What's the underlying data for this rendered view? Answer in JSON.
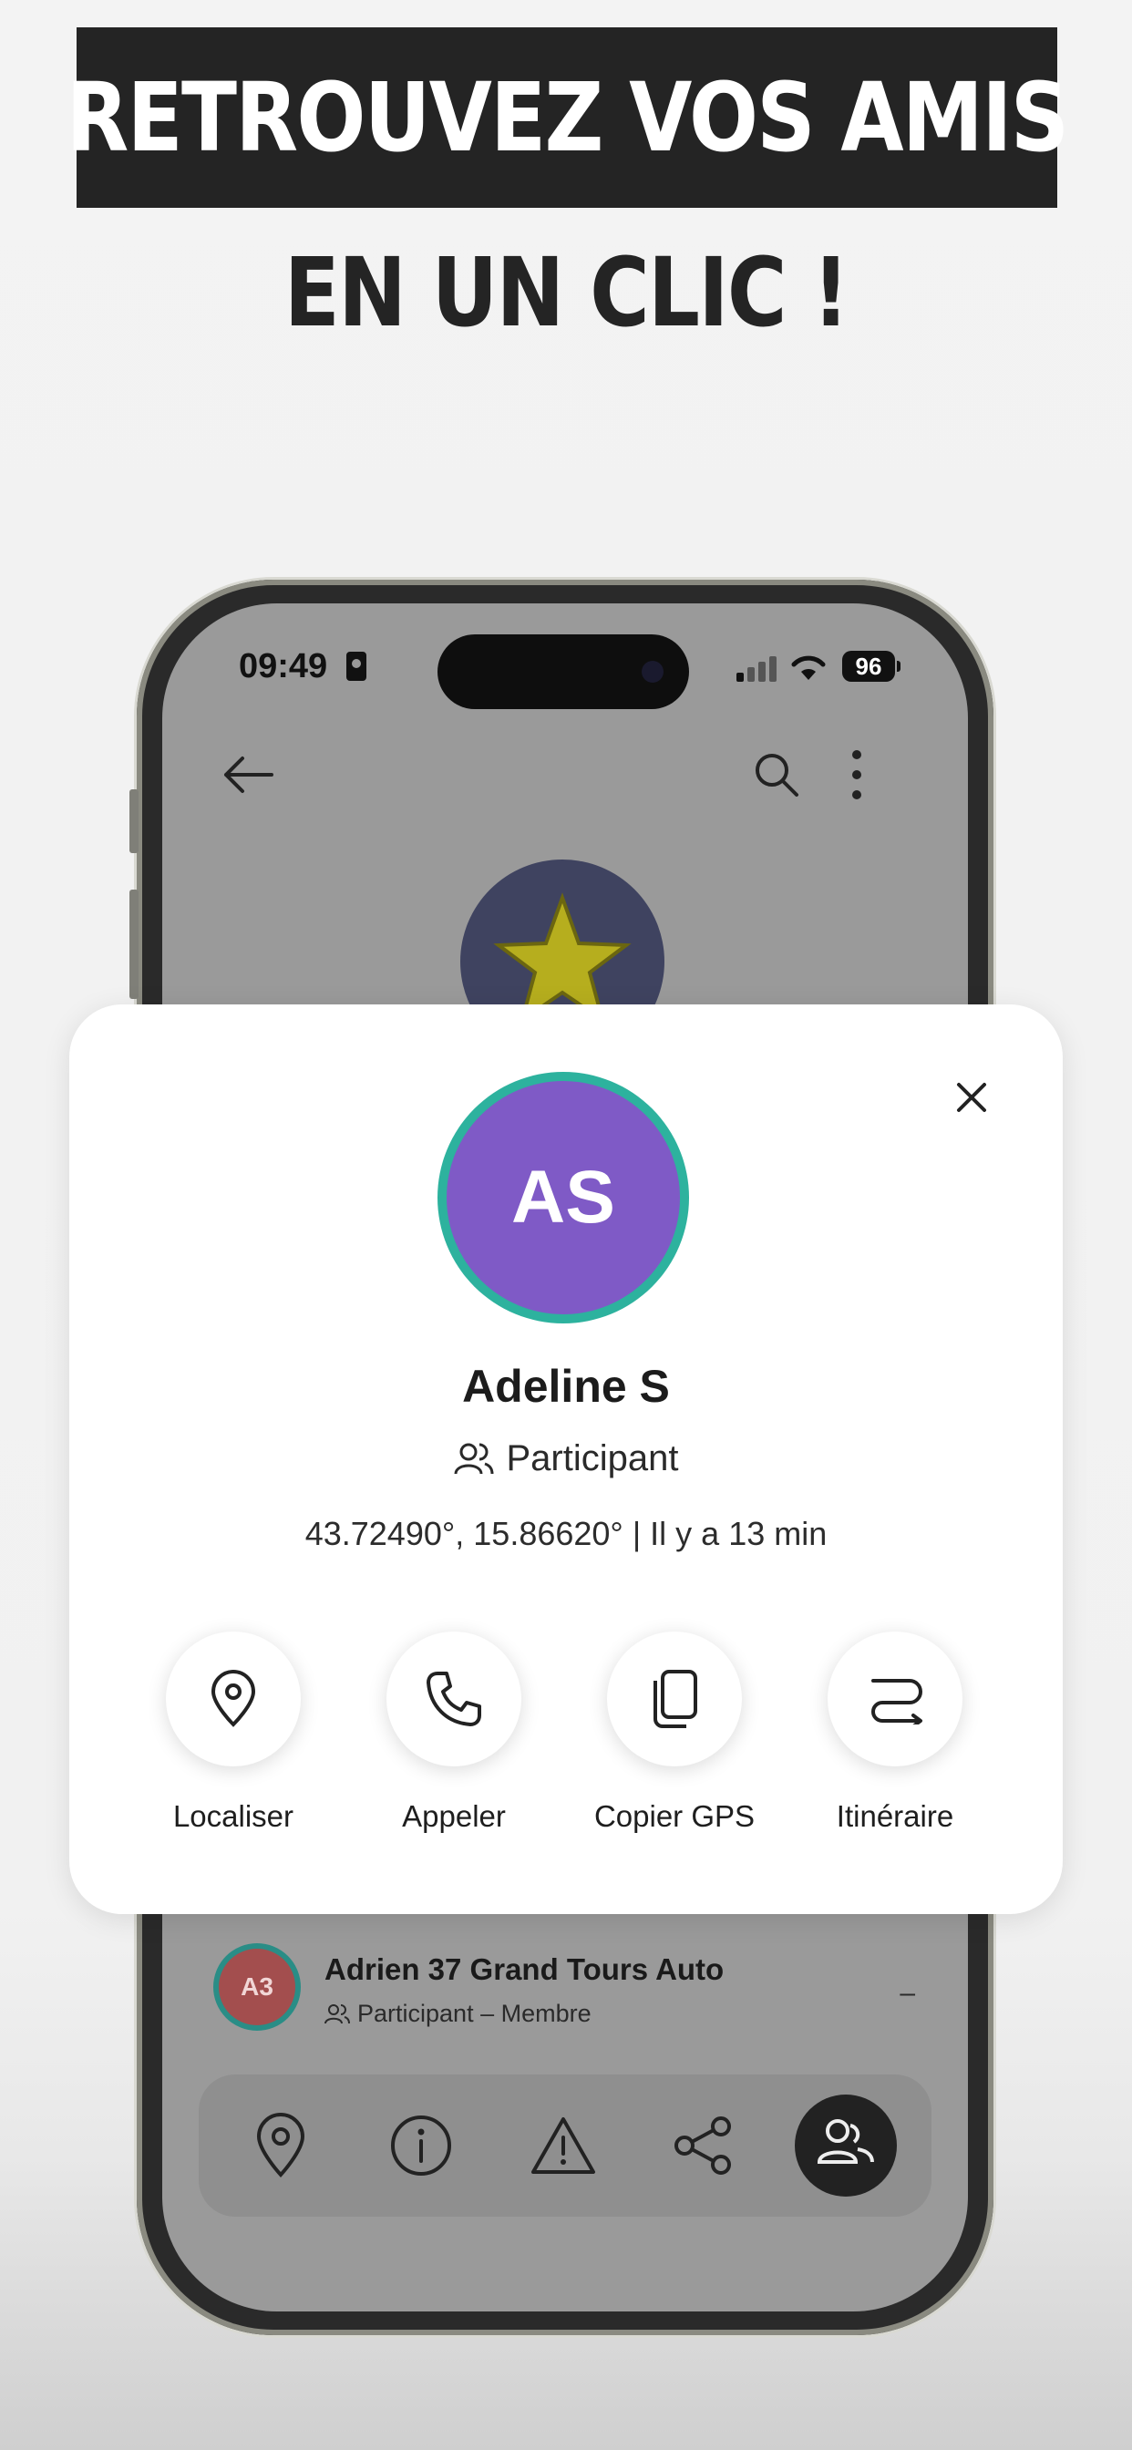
{
  "headline": {
    "line1": "RETROUVEZ VOS AMIS",
    "line2": "EN UN CLIC !"
  },
  "status_bar": {
    "time": "09:49",
    "battery": "96"
  },
  "background_member": {
    "initials": "A3",
    "name": "Adrien 37 Grand Tours Auto",
    "role": "Participant – Membre",
    "trailing": "–"
  },
  "card": {
    "initials": "AS",
    "name": "Adeline S",
    "role": "Participant",
    "coords": "43.72490°, 15.86620°  |  Il y a 13 min",
    "actions": [
      {
        "label": "Localiser",
        "icon": "map-pin-icon"
      },
      {
        "label": "Appeler",
        "icon": "phone-icon"
      },
      {
        "label": "Copier GPS",
        "icon": "copy-icon"
      },
      {
        "label": "Itinéraire",
        "icon": "route-icon"
      }
    ]
  },
  "bottom_nav": [
    "map-pin-icon",
    "info-icon",
    "warning-icon",
    "share-icon",
    "members-icon"
  ],
  "colors": {
    "avatar_ring": "#2db29e",
    "avatar_fill": "#7f5ac6",
    "member_avatar_fill": "#a34e4e",
    "headline_box": "#242424"
  }
}
